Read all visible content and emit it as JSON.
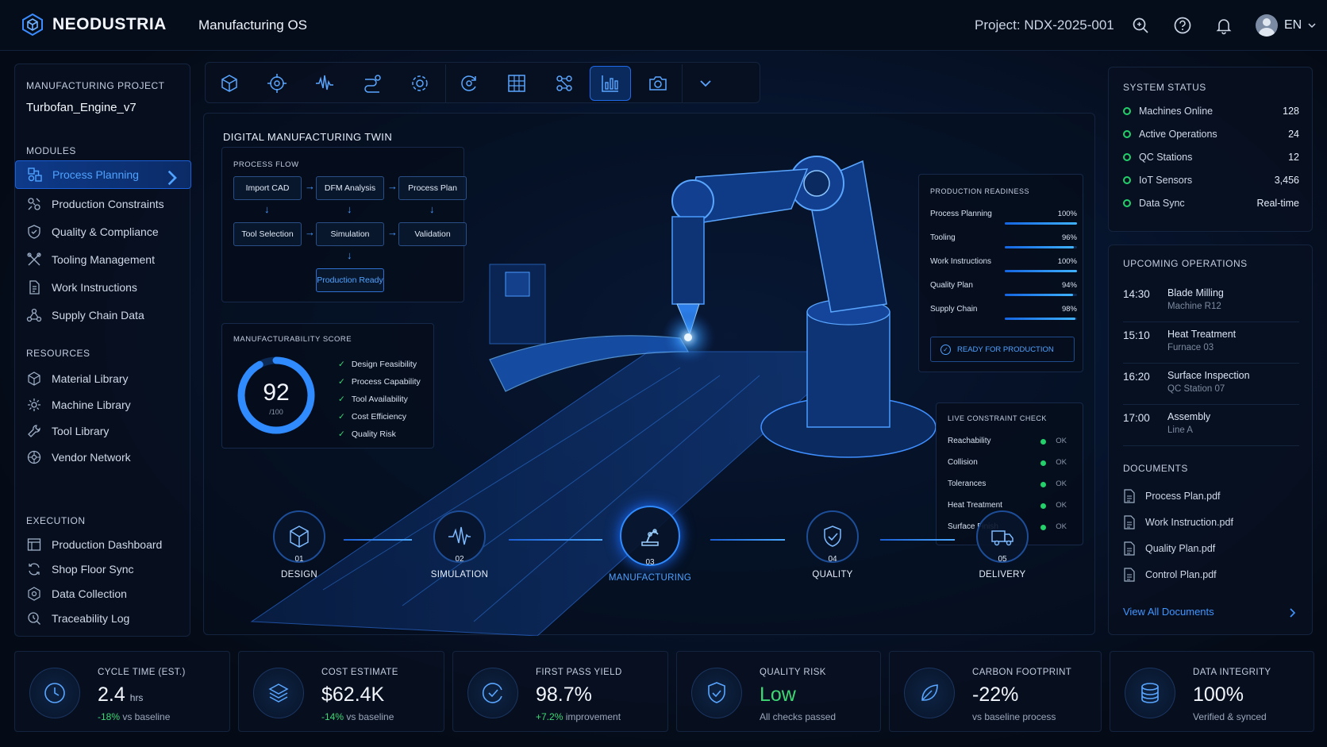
{
  "header": {
    "brand": "NEODUSTRIA",
    "app_title": "Manufacturing OS",
    "project": "Project: NDX-2025-001",
    "language": "EN"
  },
  "sidebar": {
    "project_label": "MANUFACTURING PROJECT",
    "project_name": "Turbofan_Engine_v7",
    "modules_label": "MODULES",
    "modules": [
      {
        "label": "Process Planning",
        "icon": "process-icon",
        "active": true
      },
      {
        "label": "Production Constraints",
        "icon": "constraints-icon"
      },
      {
        "label": "Quality & Compliance",
        "icon": "shield-icon"
      },
      {
        "label": "Tooling Management",
        "icon": "tools-icon"
      },
      {
        "label": "Work Instructions",
        "icon": "document-icon"
      },
      {
        "label": "Supply Chain Data",
        "icon": "network-icon"
      }
    ],
    "resources_label": "RESOURCES",
    "resources": [
      {
        "label": "Material Library",
        "icon": "cube-icon"
      },
      {
        "label": "Machine Library",
        "icon": "gear-icon"
      },
      {
        "label": "Tool Library",
        "icon": "wrench-icon"
      },
      {
        "label": "Vendor Network",
        "icon": "network-icon"
      }
    ],
    "execution_label": "EXECUTION",
    "execution": [
      {
        "label": "Production Dashboard",
        "icon": "dashboard-icon"
      },
      {
        "label": "Shop Floor Sync",
        "icon": "sync-icon"
      },
      {
        "label": "Data Collection",
        "icon": "data-icon"
      },
      {
        "label": "Traceability Log",
        "icon": "log-icon"
      }
    ]
  },
  "toolbar": {
    "tools": [
      "cube-icon",
      "target-icon",
      "waveform-icon",
      "flow-icon",
      "gear-icon",
      "cycle-icon",
      "grid-icon",
      "nodes-icon",
      "chart-icon",
      "camera-icon",
      "chevron-down-icon"
    ],
    "active_tool": "chart-icon"
  },
  "twin": {
    "title": "DIGITAL MANUFACTURING TWIN",
    "process_flow": {
      "label": "PROCESS FLOW",
      "nodes": [
        "Import CAD",
        "DFM Analysis",
        "Process Plan",
        "Tool Selection",
        "Simulation",
        "Validation",
        "Production Ready"
      ]
    },
    "score": {
      "label": "MANUFACTURABILITY SCORE",
      "value": "92",
      "max": "/100",
      "fraction": 0.92,
      "checks": [
        "Design Feasibility",
        "Process Capability",
        "Tool Availability",
        "Cost Efficiency",
        "Quality Risk"
      ]
    },
    "readiness": {
      "label": "PRODUCTION READINESS",
      "items": [
        {
          "label": "Process Planning",
          "value": "100%",
          "fraction": 1.0
        },
        {
          "label": "Tooling",
          "value": "96%",
          "fraction": 0.96
        },
        {
          "label": "Work Instructions",
          "value": "100%",
          "fraction": 1.0
        },
        {
          "label": "Quality Plan",
          "value": "94%",
          "fraction": 0.94
        },
        {
          "label": "Supply Chain",
          "value": "98%",
          "fraction": 0.98
        }
      ],
      "status": "READY FOR PRODUCTION"
    },
    "constraints": {
      "label": "LIVE CONSTRAINT CHECK",
      "items": [
        {
          "label": "Reachability",
          "status": "OK"
        },
        {
          "label": "Collision",
          "status": "OK"
        },
        {
          "label": "Tolerances",
          "status": "OK"
        },
        {
          "label": "Heat Treatment",
          "status": "OK"
        },
        {
          "label": "Surface Finish",
          "status": "OK"
        }
      ]
    },
    "stages": [
      {
        "num": "01",
        "label": "DESIGN",
        "icon": "cube-icon"
      },
      {
        "num": "02",
        "label": "SIMULATION",
        "icon": "waveform-icon"
      },
      {
        "num": "03",
        "label": "MANUFACTURING",
        "icon": "robot-arm-icon",
        "active": true
      },
      {
        "num": "04",
        "label": "QUALITY",
        "icon": "shield-check-icon"
      },
      {
        "num": "05",
        "label": "DELIVERY",
        "icon": "truck-icon"
      }
    ]
  },
  "system_status": {
    "label": "SYSTEM STATUS",
    "rows": [
      {
        "label": "Machines Online",
        "value": "128"
      },
      {
        "label": "Active Operations",
        "value": "24"
      },
      {
        "label": "QC Stations",
        "value": "12"
      },
      {
        "label": "IoT Sensors",
        "value": "3,456"
      },
      {
        "label": "Data Sync",
        "value": "Real-time"
      }
    ]
  },
  "operations": {
    "label": "UPCOMING OPERATIONS",
    "items": [
      {
        "time": "14:30",
        "name": "Blade Milling",
        "sub": "Machine R12"
      },
      {
        "time": "15:10",
        "name": "Heat Treatment",
        "sub": "Furnace 03"
      },
      {
        "time": "16:20",
        "name": "Surface Inspection",
        "sub": "QC Station 07"
      },
      {
        "time": "17:00",
        "name": "Assembly",
        "sub": "Line A"
      }
    ]
  },
  "documents": {
    "label": "DOCUMENTS",
    "items": [
      "Process Plan.pdf",
      "Work Instruction.pdf",
      "Quality Plan.pdf",
      "Control Plan.pdf"
    ],
    "view_all": "View All Documents"
  },
  "kpis": [
    {
      "label": "CYCLE TIME (EST.)",
      "value": "2.4",
      "unit": "hrs",
      "delta": "-18%",
      "sub": " vs baseline",
      "icon": "clock-icon"
    },
    {
      "label": "COST ESTIMATE",
      "value": "$62.4K",
      "unit": "",
      "delta": "-14%",
      "sub": " vs baseline",
      "icon": "layers-icon"
    },
    {
      "label": "FIRST PASS YIELD",
      "value": "98.7%",
      "unit": "",
      "delta": "+7.2%",
      "sub": " improvement",
      "icon": "check-cycle-icon"
    },
    {
      "label": "QUALITY RISK",
      "value": "Low",
      "unit": "",
      "delta": "",
      "sub": "All checks passed",
      "icon": "shield-check-icon"
    },
    {
      "label": "CARBON FOOTPRINT",
      "value": "-22%",
      "unit": "",
      "delta": "",
      "sub": "vs baseline process",
      "icon": "leaf-icon"
    },
    {
      "label": "DATA INTEGRITY",
      "value": "100%",
      "unit": "",
      "delta": "",
      "sub": "Verified & synced",
      "icon": "database-icon"
    }
  ],
  "colors": {
    "accent": "#2f8bff",
    "ok": "#23d06a",
    "background": "#050b16"
  }
}
